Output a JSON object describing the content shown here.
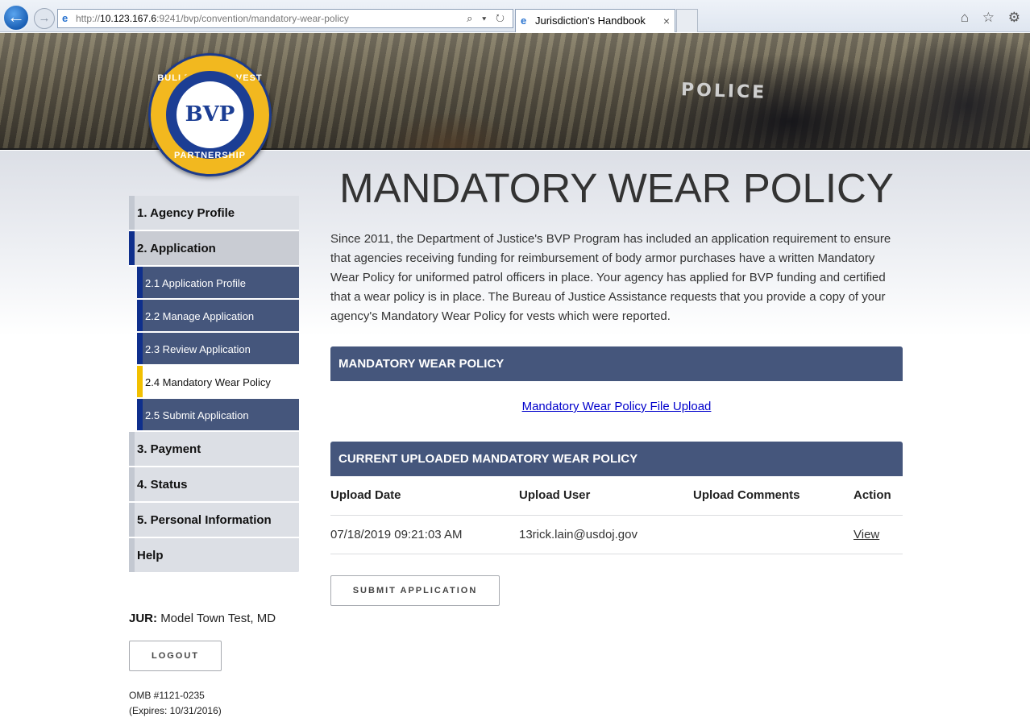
{
  "browser": {
    "url_prefix": "http://",
    "url_host": "10.123.167.6",
    "url_rest": ":9241/bvp/convention/mandatory-wear-policy",
    "address_tools": "⌕ ▾ ↻",
    "tab_title": "Jurisdiction's Handbook",
    "tab_close": "×",
    "back_glyph": "←",
    "forward_glyph": "→",
    "toolbar_icons": "⌂ ☆ ⚙"
  },
  "banner": {
    "police_text": "POLICE"
  },
  "logo": {
    "top_text": "BULLETPROOF VEST",
    "center_text": "BVP",
    "bottom_text": "PARTNERSHIP"
  },
  "sidebar": {
    "items": [
      {
        "label": "1. Agency Profile"
      },
      {
        "label": "2. Application"
      },
      {
        "label": "3. Payment"
      },
      {
        "label": "4. Status"
      },
      {
        "label": "5. Personal Information"
      },
      {
        "label": "Help"
      }
    ],
    "subitems": [
      {
        "label": "2.1 Application Profile"
      },
      {
        "label": "2.2 Manage Application"
      },
      {
        "label": "2.3 Review Application"
      },
      {
        "label": "2.4 Mandatory Wear Policy"
      },
      {
        "label": "2.5 Submit Application"
      }
    ],
    "jur_label": "JUR:",
    "jur_value": "Model Town Test, MD",
    "logout_label": "LOGOUT",
    "omb_number": "OMB #1121-0235",
    "omb_expires": "(Expires: 10/31/2016)"
  },
  "main": {
    "title": "MANDATORY WEAR POLICY",
    "intro": "Since 2011, the Department of Justice's BVP Program has included an application requirement to ensure that agencies receiving funding for reimbursement of body armor purchases have a written Mandatory Wear Policy for uniformed patrol officers in place. Your agency has applied for BVP funding and certified that a wear policy is in place. The Bureau of Justice Assistance requests that you provide a copy of your agency's Mandatory Wear Policy for vests which were reported.",
    "panel1_title": "MANDATORY WEAR POLICY",
    "upload_link": "Mandatory Wear Policy File Upload",
    "panel2_title": "CURRENT UPLOADED MANDATORY WEAR POLICY",
    "table": {
      "headers": [
        "Upload Date",
        "Upload User",
        "Upload Comments",
        "Action"
      ],
      "rows": [
        [
          "07/18/2019 09:21:03 AM",
          "13rick.lain@usdoj.gov",
          "",
          "View"
        ]
      ]
    },
    "submit_label": "SUBMIT APPLICATION"
  }
}
